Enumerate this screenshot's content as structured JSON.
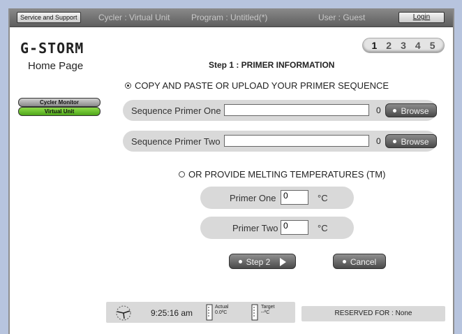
{
  "topbar": {
    "service_label": "Service and Support",
    "cycler": "Cycler : Virtual Unit",
    "program": "Program : Untitled(*)",
    "user": "User : Guest",
    "login_label": "Login"
  },
  "sidebar": {
    "logo": "G-STORM",
    "home": "Home Page",
    "cycler_monitor": "Cycler Monitor",
    "virtual_unit": "Virtual Unit"
  },
  "steps": {
    "items": [
      "1",
      "2",
      "3",
      "4",
      "5"
    ],
    "active": "1"
  },
  "main": {
    "title": "Step 1 : PRIMER INFORMATION",
    "option_sequence": "COPY AND PASTE OR UPLOAD YOUR PRIMER SEQUENCE",
    "option_tm": "OR PROVIDE MELTING TEMPERATURES (TM)",
    "seq_one_label": "Sequence Primer One",
    "seq_one_value": "",
    "seq_one_count": "0",
    "seq_two_label": "Sequence Primer Two",
    "seq_two_value": "",
    "seq_two_count": "0",
    "browse_label": "Browse",
    "tm_one_label": "Primer One",
    "tm_one_value": "0",
    "tm_two_label": "Primer Two",
    "tm_two_value": "0",
    "unit": "°C",
    "step2_label": "Step 2",
    "cancel_label": "Cancel"
  },
  "status": {
    "time": "9:25:16 am",
    "actual_label": "Actual",
    "actual_value": "0.0ºC",
    "target_label": "Target",
    "target_value": "--ºC",
    "reserved": "RESERVED FOR : None"
  },
  "colors": {
    "background": "#b7c4de",
    "green": "#6cc232",
    "button_dark": "#4a4a4a",
    "panel": "#d9d9d9"
  }
}
